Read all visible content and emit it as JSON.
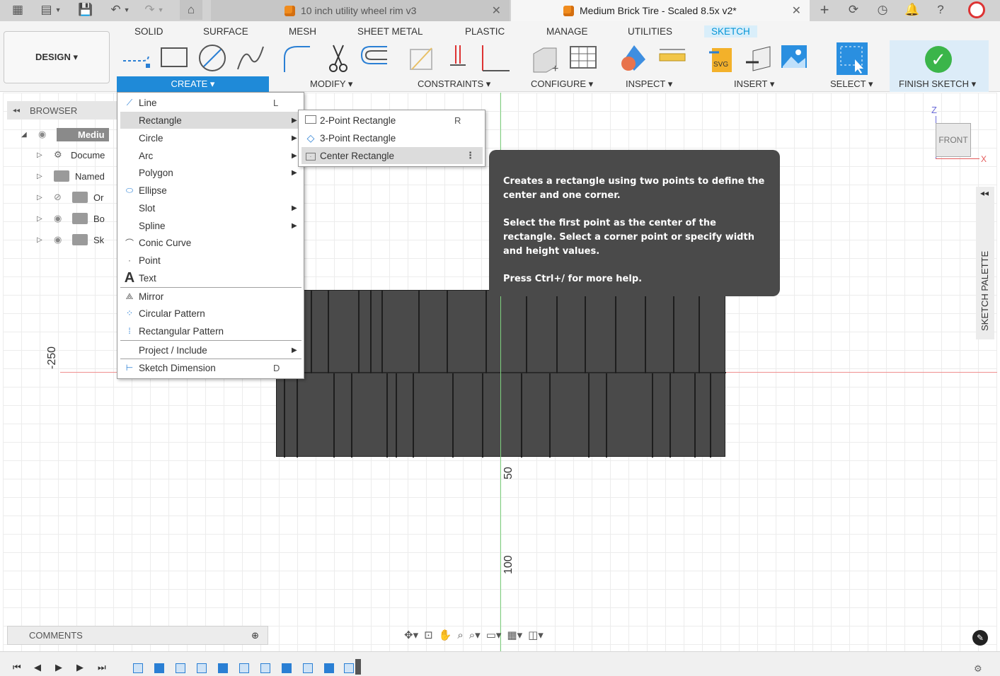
{
  "tabs": {
    "doc1": "10 inch utility wheel rim v3",
    "doc2": "Medium Brick Tire - Scaled 8.5x v2*"
  },
  "workspace": {
    "label": "DESIGN ▾"
  },
  "ribbon_tabs": [
    "SOLID",
    "SURFACE",
    "MESH",
    "SHEET METAL",
    "PLASTIC",
    "MANAGE",
    "UTILITIES",
    "SKETCH"
  ],
  "groups": {
    "create": "CREATE ▾",
    "modify": "MODIFY ▾",
    "constraints": "CONSTRAINTS ▾",
    "configure": "CONFIGURE ▾",
    "inspect": "INSPECT ▾",
    "insert": "INSERT ▾",
    "select": "SELECT ▾",
    "finish": "FINISH SKETCH ▾"
  },
  "browser": {
    "title": "BROWSER",
    "items": [
      "Mediu",
      "Docume",
      "Named",
      "Or",
      "Bo",
      "Sk"
    ]
  },
  "create_menu": {
    "line": {
      "label": "Line",
      "shortcut": "L"
    },
    "rectangle": {
      "label": "Rectangle"
    },
    "circle": {
      "label": "Circle"
    },
    "arc": {
      "label": "Arc"
    },
    "polygon": {
      "label": "Polygon"
    },
    "ellipse": {
      "label": "Ellipse"
    },
    "slot": {
      "label": "Slot"
    },
    "spline": {
      "label": "Spline"
    },
    "conic": {
      "label": "Conic Curve"
    },
    "point": {
      "label": "Point"
    },
    "text": {
      "label": "Text"
    },
    "mirror": {
      "label": "Mirror"
    },
    "circular_pattern": {
      "label": "Circular Pattern"
    },
    "rect_pattern": {
      "label": "Rectangular Pattern"
    },
    "project": {
      "label": "Project / Include"
    },
    "sketch_dim": {
      "label": "Sketch Dimension",
      "shortcut": "D"
    }
  },
  "rect_submenu": {
    "two_point": {
      "label": "2-Point Rectangle",
      "shortcut": "R"
    },
    "three_point": {
      "label": "3-Point Rectangle"
    },
    "center": {
      "label": "Center Rectangle"
    }
  },
  "tooltip": {
    "line1": "Creates a rectangle using two points to define the center and one corner.",
    "line2": "Select the first point as the center of the rectangle. Select a corner point or specify width and height values.",
    "line3": "Press Ctrl+/ for more help."
  },
  "axis_labels": {
    "y_neg": "-250",
    "v50": "50",
    "v100": "100"
  },
  "viewcube": {
    "face": "FRONT",
    "z": "Z",
    "x": "X"
  },
  "palette": {
    "label": "SKETCH PALETTE"
  },
  "comments": {
    "label": "COMMENTS"
  },
  "colors": {
    "accent": "#0696d7",
    "create_bar": "#1f8ad8",
    "finish_bg": "#dcecf8",
    "check": "#3bb54a",
    "tooltip_bg": "#4a4a4a"
  }
}
